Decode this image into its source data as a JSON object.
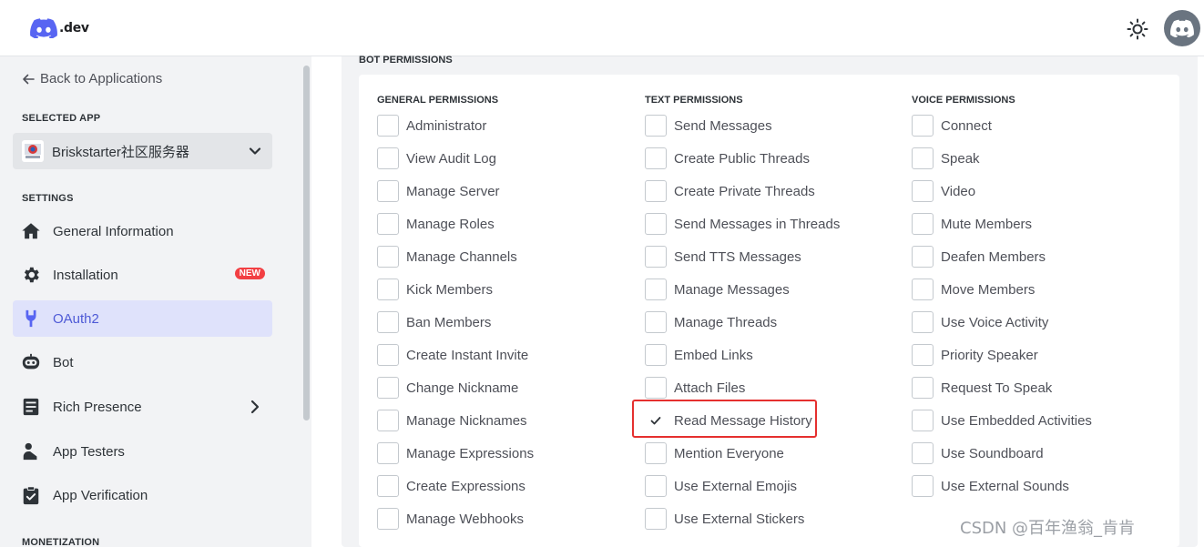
{
  "header": {
    "logo_text": ".dev"
  },
  "sidebar": {
    "back_label": "Back to Applications",
    "selected_app_label": "SELECTED APP",
    "selected_app_name": "Briskstarter社区服务器",
    "settings_label": "SETTINGS",
    "items": [
      {
        "label": "General Information",
        "icon": "home-icon"
      },
      {
        "label": "Installation",
        "icon": "gear-icon",
        "badge": "NEW"
      },
      {
        "label": "OAuth2",
        "icon": "wrench-icon",
        "active": true
      },
      {
        "label": "Bot",
        "icon": "bot-icon"
      },
      {
        "label": "Rich Presence",
        "icon": "document-icon"
      },
      {
        "label": "App Testers",
        "icon": "user-icon"
      },
      {
        "label": "App Verification",
        "icon": "clipboard-check-icon"
      }
    ],
    "monetization_label": "MONETIZATION"
  },
  "permissions": {
    "title": "BOT PERMISSIONS",
    "columns": [
      {
        "header": "GENERAL PERMISSIONS",
        "items": [
          {
            "label": "Administrator",
            "checked": false
          },
          {
            "label": "View Audit Log",
            "checked": false
          },
          {
            "label": "Manage Server",
            "checked": false
          },
          {
            "label": "Manage Roles",
            "checked": false
          },
          {
            "label": "Manage Channels",
            "checked": false
          },
          {
            "label": "Kick Members",
            "checked": false
          },
          {
            "label": "Ban Members",
            "checked": false
          },
          {
            "label": "Create Instant Invite",
            "checked": false
          },
          {
            "label": "Change Nickname",
            "checked": false
          },
          {
            "label": "Manage Nicknames",
            "checked": false
          },
          {
            "label": "Manage Expressions",
            "checked": false
          },
          {
            "label": "Create Expressions",
            "checked": false
          },
          {
            "label": "Manage Webhooks",
            "checked": false
          }
        ]
      },
      {
        "header": "TEXT PERMISSIONS",
        "items": [
          {
            "label": "Send Messages",
            "checked": false
          },
          {
            "label": "Create Public Threads",
            "checked": false
          },
          {
            "label": "Create Private Threads",
            "checked": false
          },
          {
            "label": "Send Messages in Threads",
            "checked": false
          },
          {
            "label": "Send TTS Messages",
            "checked": false
          },
          {
            "label": "Manage Messages",
            "checked": false
          },
          {
            "label": "Manage Threads",
            "checked": false
          },
          {
            "label": "Embed Links",
            "checked": false
          },
          {
            "label": "Attach Files",
            "checked": false
          },
          {
            "label": "Read Message History",
            "checked": true
          },
          {
            "label": "Mention Everyone",
            "checked": false
          },
          {
            "label": "Use External Emojis",
            "checked": false
          },
          {
            "label": "Use External Stickers",
            "checked": false
          }
        ]
      },
      {
        "header": "VOICE PERMISSIONS",
        "items": [
          {
            "label": "Connect",
            "checked": false
          },
          {
            "label": "Speak",
            "checked": false
          },
          {
            "label": "Video",
            "checked": false
          },
          {
            "label": "Mute Members",
            "checked": false
          },
          {
            "label": "Deafen Members",
            "checked": false
          },
          {
            "label": "Move Members",
            "checked": false
          },
          {
            "label": "Use Voice Activity",
            "checked": false
          },
          {
            "label": "Priority Speaker",
            "checked": false
          },
          {
            "label": "Request To Speak",
            "checked": false
          },
          {
            "label": "Use Embedded Activities",
            "checked": false
          },
          {
            "label": "Use Soundboard",
            "checked": false
          },
          {
            "label": "Use External Sounds",
            "checked": false
          }
        ]
      }
    ]
  },
  "watermark": "CSDN @百年渔翁_肯肯",
  "colors": {
    "accent": "#5865f2",
    "active_bg": "#dfe2fb",
    "highlight": "#e5302f",
    "badge": "#f23f43"
  }
}
